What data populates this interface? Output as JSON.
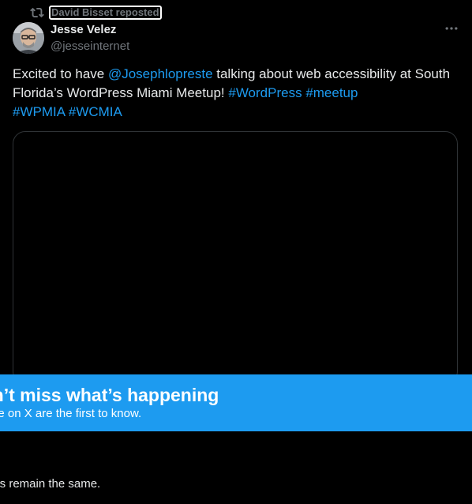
{
  "repost": {
    "label": "David Bisset reposted",
    "icon": "repost-icon"
  },
  "author": {
    "name": "Jesse Velez",
    "handle": "@jesseinternet",
    "avatar_icon": "avatar-photo"
  },
  "more_icon": "more-horizontal-icon",
  "tweet": {
    "t1": "Excited to have ",
    "mention": "@Josephlopreste",
    "t2": " talking about web accessibility at South Florida’s WordPress Miami Meetup! ",
    "tag1": "#WordPress",
    "sp1": " ",
    "tag2": "#meetup",
    "sp2": " ",
    "tag3": "#WPMIA",
    "sp3": " ",
    "tag4": "#WCMIA"
  },
  "banner": {
    "title": "Don’t miss what’s happening",
    "subtitle": "People on X are the first to know."
  },
  "bottom": {
    "note": "Your settings remain the same."
  },
  "colors": {
    "background": "#000000",
    "accent": "#1d9bf0",
    "text": "#e7e9ea",
    "muted": "#71767b",
    "border": "#2f3336"
  }
}
